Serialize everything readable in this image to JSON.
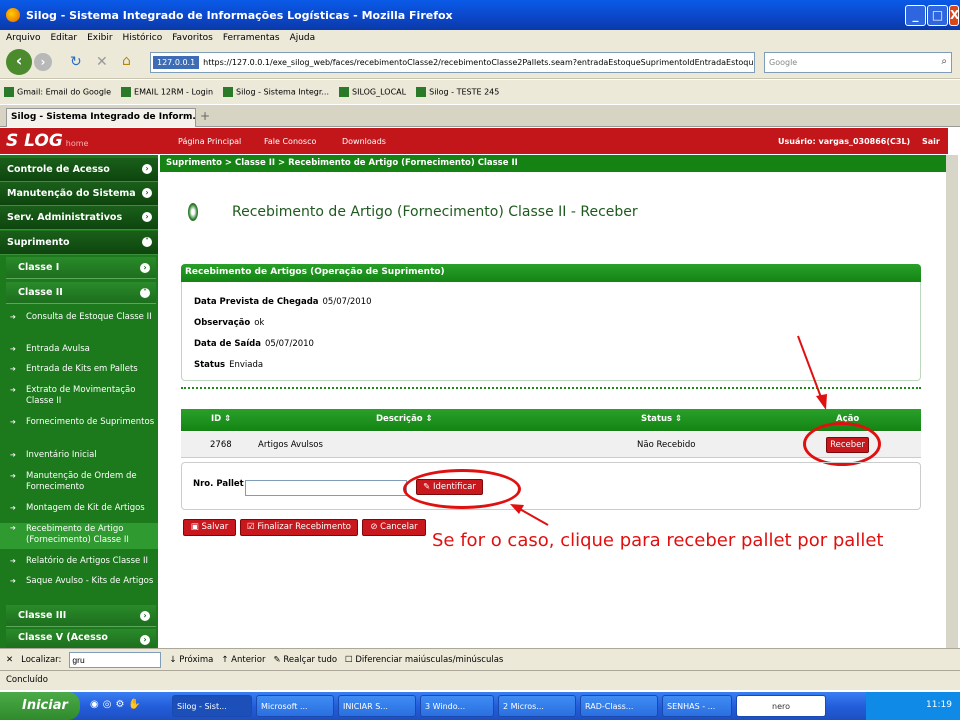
{
  "window": {
    "title": "Silog - Sistema Integrado de Informações Logísticas - Mozilla Firefox"
  },
  "menu": [
    "Arquivo",
    "Editar",
    "Exibir",
    "Histórico",
    "Favoritos",
    "Ferramentas",
    "Ajuda"
  ],
  "nav": {
    "site_badge": "127.0.0.1",
    "url": "https://127.0.0.1/exe_silog_web/faces/recebimentoClasse2/recebimentoClasse2Pallets.seam?entradaEstoqueSuprimentoIdEntradaEstoqueSup",
    "search_placeholder": "Google"
  },
  "bookmarks": [
    "Gmail: Email do Google",
    "EMAIL 12RM - Login",
    "Silog - Sistema Integr...",
    "SILOG_LOCAL",
    "Silog - TESTE 245"
  ],
  "tab": {
    "label": "Silog - Sistema Integrado de Inform..."
  },
  "app": {
    "logo": "S LOG",
    "logo_sub": "home",
    "links": {
      "home": "Página Principal",
      "contact": "Fale Conosco",
      "downloads": "Downloads"
    },
    "user": "Usuário: vargas_030866(C3L)",
    "exit": "Sair",
    "breadcrumb": "Suprimento > Classe II > Recebimento de Artigo (Fornecimento) Classe II"
  },
  "sidebar": {
    "main": [
      "Controle de Acesso",
      "Manutenção do Sistema",
      "Serv. Administrativos",
      "Suprimento"
    ],
    "class1": "Classe I",
    "class2": "Classe II",
    "items": [
      "Consulta de Estoque Classe II",
      "Entrada Avulsa",
      "Entrada de Kits em Pallets",
      "Extrato de Movimentação Classe II",
      "Fornecimento de Suprimentos",
      "Inventário Inicial",
      "Manutenção de Ordem de Fornecimento",
      "Montagem de Kit de Artigos",
      "Recebimento de Artigo (Fornecimento) Classe II",
      "Relatório de Artigos Classe II",
      "Saque Avulso - Kits de Artigos"
    ],
    "class3": "Classe III",
    "class5": "Classe V (Acesso"
  },
  "page": {
    "title": "Recebimento de Artigo (Fornecimento) Classe II - Receber",
    "panel_title": "Recebimento de Artigos (Operação de Suprimento)",
    "fields": [
      {
        "label": "Data Prevista de Chegada",
        "value": "05/07/2010"
      },
      {
        "label": "Observação",
        "value": "ok"
      },
      {
        "label": "Data de Saída",
        "value": "05/07/2010"
      },
      {
        "label": "Status",
        "value": "Enviada"
      }
    ],
    "table": {
      "headers": [
        "ID ⇕",
        "Descrição ⇕",
        "Status ⇕",
        "Ação"
      ],
      "row": {
        "id": "2768",
        "desc": "Artigos Avulsos",
        "status": "Não Recebido",
        "action": "Receber"
      }
    },
    "pallet_label": "Nro. Pallet",
    "identify": "Identificar",
    "buttons": {
      "save": "Salvar",
      "finish": "Finalizar Recebimento",
      "cancel": "Cancelar"
    },
    "annotation": "Se for o caso, clique para receber pallet por pallet"
  },
  "findbar": {
    "label": "Localizar:",
    "value": "gru",
    "next": "Próxima",
    "prev": "Anterior",
    "highlight": "Realçar tudo",
    "case": "Diferenciar maiúsculas/minúsculas"
  },
  "status": "Concluído",
  "taskbar": {
    "start": "Iniciar",
    "tasks": [
      "Silog - Sist...",
      "Microsoft ...",
      "INICIAR S...",
      "3 Windo...",
      "2 Micros...",
      "RAD-Class...",
      "SENHAS - ...",
      "nero"
    ],
    "clock": "11:19"
  }
}
